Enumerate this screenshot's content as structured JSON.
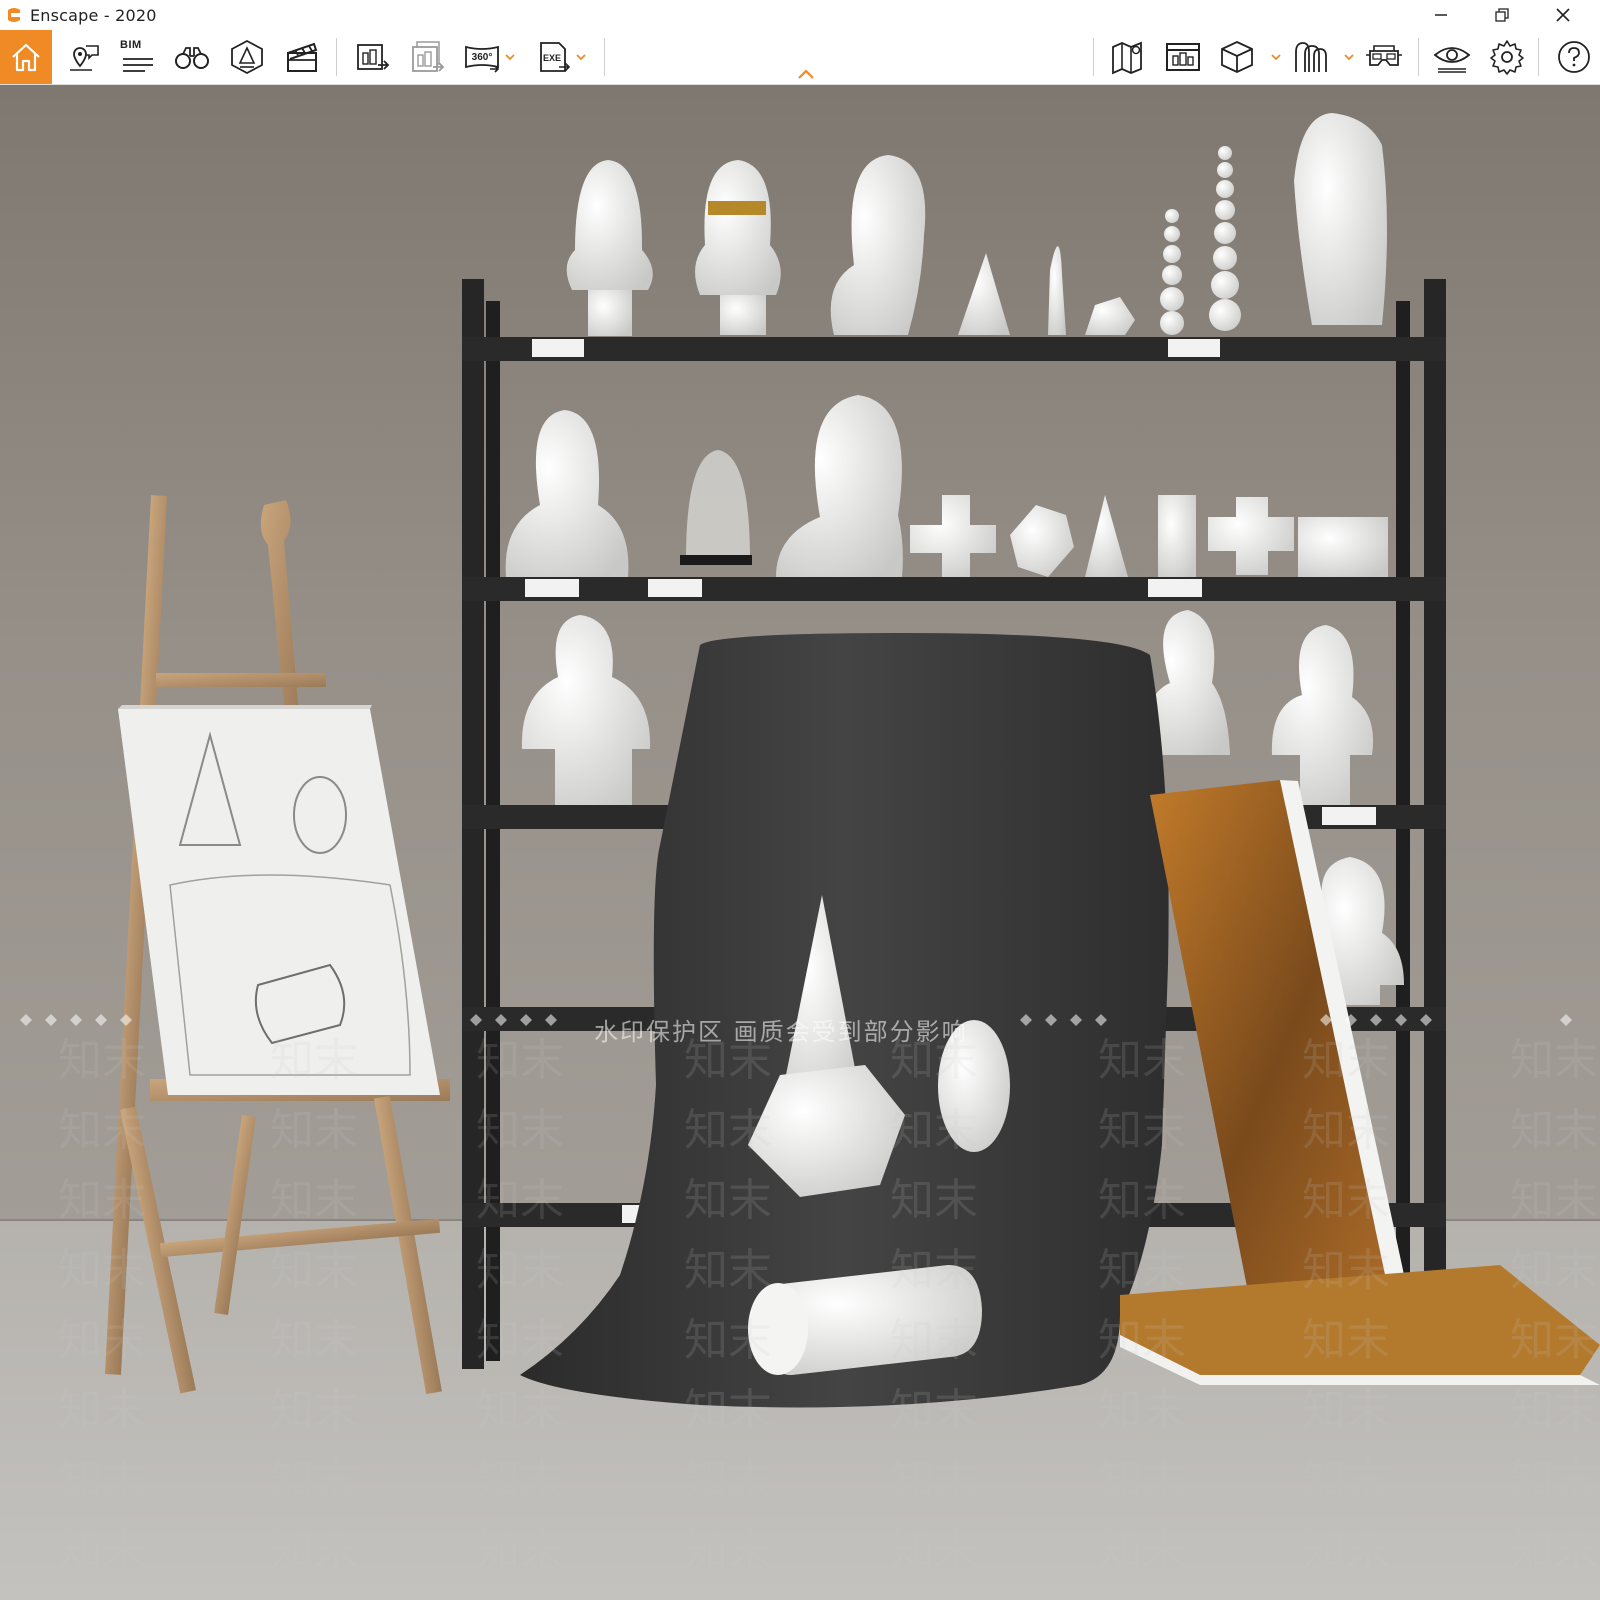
{
  "window": {
    "title": "Enscape - 2020",
    "controls": [
      "minimize",
      "restore",
      "close"
    ]
  },
  "toolbar": {
    "bim_label": "BIM",
    "buttons": [
      {
        "icon": "home-icon",
        "active": true
      },
      {
        "icon": "location-chat-icon"
      },
      {
        "icon": "bim-icon"
      },
      {
        "icon": "binoculars-icon"
      },
      {
        "icon": "atmosphere-icon"
      },
      {
        "icon": "clapperboard-icon"
      },
      {
        "icon": "render-export-icon"
      },
      {
        "icon": "batch-render-icon"
      },
      {
        "icon": "panorama-360-icon"
      },
      {
        "icon": "exe-export-icon"
      },
      {
        "icon": "map-icon"
      },
      {
        "icon": "asset-library-icon"
      },
      {
        "icon": "cube-view-icon"
      },
      {
        "icon": "vr-headset-icon"
      },
      {
        "icon": "eye-view-icon"
      },
      {
        "icon": "settings-icon"
      },
      {
        "icon": "help-icon"
      }
    ],
    "pano_label": "360°",
    "exe_label": "EXE"
  },
  "viewport": {
    "watermark_notice": "水印保护区   画质会受到部分影响",
    "watermark_text": "知末"
  },
  "colors": {
    "accent": "#f08a24",
    "wall": "#8e8880",
    "floor": "#b9b7b3",
    "shelf": "#2a2a2a",
    "cloth": "#3a3a3a",
    "plaster": "#eeeeec",
    "wood": "#b08a6a"
  }
}
